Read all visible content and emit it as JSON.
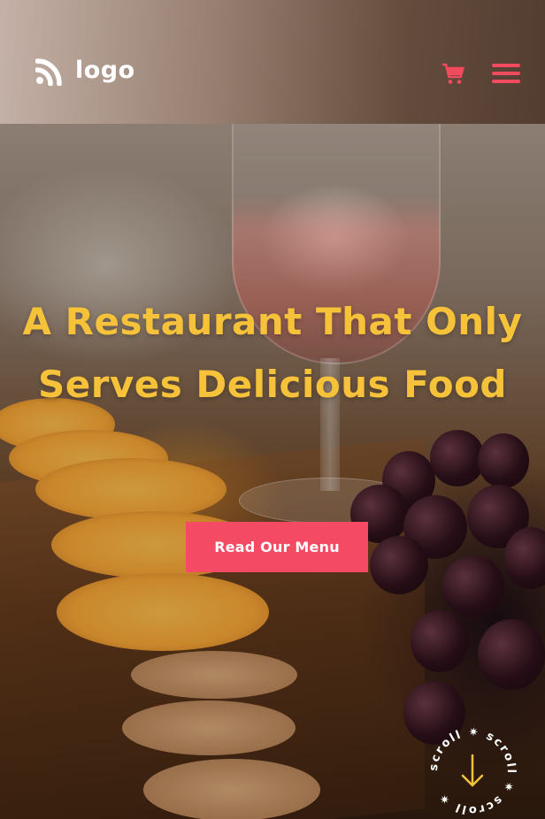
{
  "header": {
    "logo_text": "logo",
    "logo_icon": "wifi-wave-logo-icon",
    "cart_icon": "shopping-cart-icon",
    "menu_icon": "hamburger-menu-icon"
  },
  "hero": {
    "title": "A Restaurant That Only Serves Delicious Food",
    "cta_label": "Read Our Menu"
  },
  "scroll_badge": {
    "text": "scroll ✷ scroll ✷ scroll ✷",
    "icon": "arrow-down-icon"
  },
  "colors": {
    "accent": "#f54a63",
    "title": "#f6c23a",
    "scroll_arrow": "#f6c23a",
    "text_light": "#ffffff"
  }
}
